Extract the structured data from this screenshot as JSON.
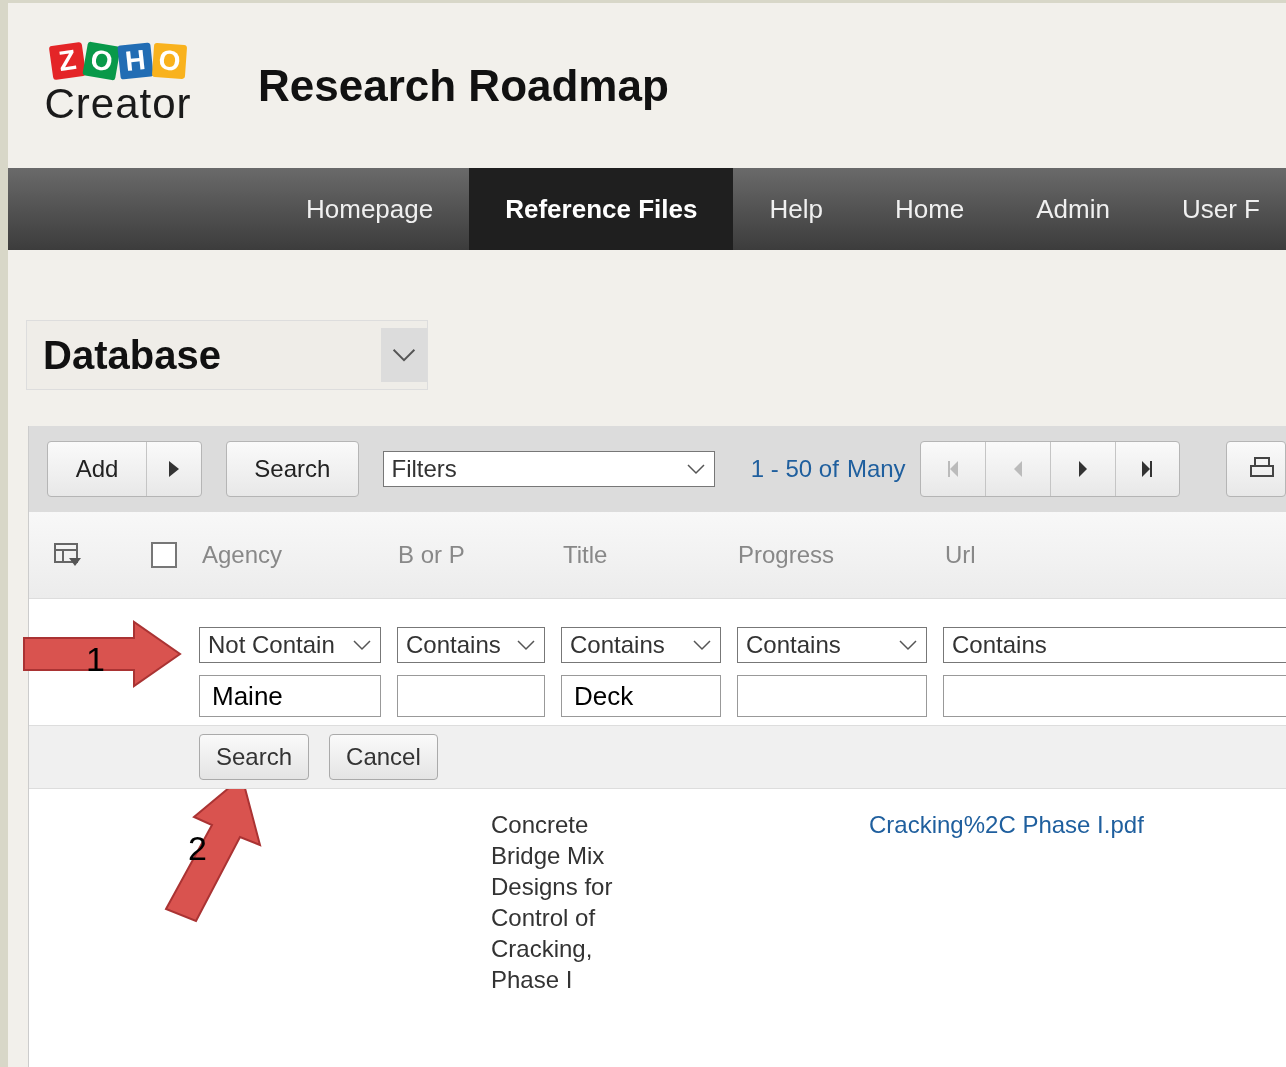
{
  "app": {
    "logo_letters": [
      {
        "letter": "Z",
        "color": "#e42527"
      },
      {
        "letter": "O",
        "color": "#089949"
      },
      {
        "letter": "H",
        "color": "#226db4"
      },
      {
        "letter": "O",
        "color": "#f9b21d"
      }
    ],
    "logo_product": "Creator",
    "title": "Research Roadmap"
  },
  "nav": [
    {
      "label": "Homepage",
      "selected": false
    },
    {
      "label": "Reference Files",
      "selected": true
    },
    {
      "label": "Help",
      "selected": false
    },
    {
      "label": "Home",
      "selected": false
    },
    {
      "label": "Admin",
      "selected": false
    },
    {
      "label": "User F",
      "selected": false
    }
  ],
  "view_selector": {
    "value": "Database"
  },
  "toolbar": {
    "add": "Add",
    "search": "Search",
    "filter_select": "Filters",
    "range": "1 - 50 of",
    "total": "Many"
  },
  "select_all": {
    "checked": false
  },
  "columns": [
    "Agency",
    "B or P",
    "Title",
    "Progress",
    "Url"
  ],
  "filters": [
    {
      "operator": "Not Contain",
      "value": "Maine"
    },
    {
      "operator": "Contains"
    },
    {
      "operator": "Contains",
      "value": "Deck"
    },
    {
      "operator": "Contains"
    },
    {
      "operator": "Contains"
    }
  ],
  "filter_actions": [
    "Search",
    "Cancel"
  ],
  "rows": [
    {
      "title": "Concrete Bridge Mix Designs for Control of Cracking, Phase I",
      "url": "Cracking%2C Phase I.pdf"
    }
  ],
  "annotations": [
    "1",
    "2"
  ]
}
